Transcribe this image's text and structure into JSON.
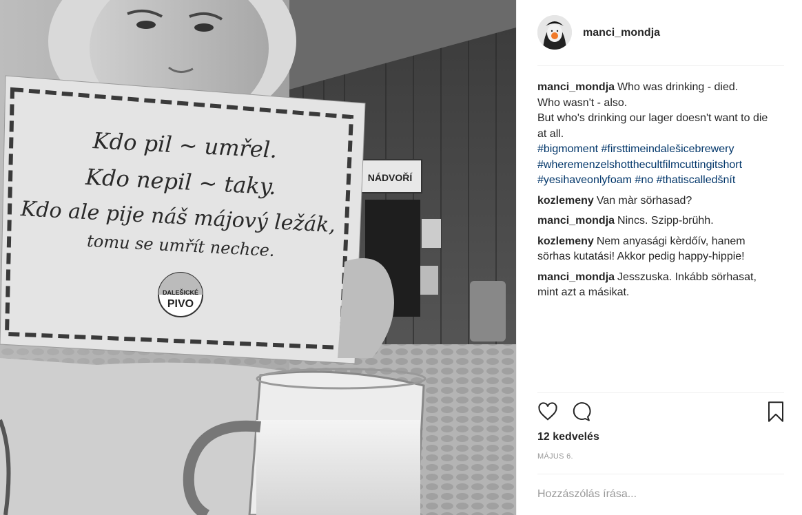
{
  "post": {
    "username": "manci_mondja",
    "avatar_icon": "profile-avatar"
  },
  "photo": {
    "sign": {
      "lines": [
        "Kdo pil ~ umřel.",
        "Kdo nepil ~ taky.",
        "Kdo ale pije náš májový ležák,",
        "tomu se umřít nechce."
      ],
      "badge_lines": [
        "DALEŠICKÉ",
        "PIVO"
      ]
    },
    "wall_sign": "NÁDVOŘÍ"
  },
  "caption": {
    "username": "manci_mondja",
    "lines": [
      "Who was drinking - died.",
      "Who wasn't - also.",
      "But who's drinking our lager doesn't want to die at all."
    ],
    "hashtags": [
      "#bigmoment",
      "#firsttimeindalešicebrewery",
      "#wheremenzelshotthecultfilmcuttingitshort",
      "#yesihaveonlyfoam",
      "#no",
      "#thatiscalledšnít"
    ]
  },
  "comments": [
    {
      "username": "kozlemeny",
      "text": "Van màr sörhasad?"
    },
    {
      "username": "manci_mondja",
      "text": "Nincs. Szipp-brühh."
    },
    {
      "username": "kozlemeny",
      "text": "Nem anyasági kèrdőív, hanem sörhas kutatási! Akkor pedig happy-hippie!"
    },
    {
      "username": "manci_mondja",
      "text": "Jesszuska. Inkább sörhasat, mint azt a másikat."
    }
  ],
  "actions": {
    "like_icon": "heart-icon",
    "comment_icon": "comment-icon",
    "save_icon": "bookmark-icon"
  },
  "likes_text": "12 kedvelés",
  "date_text": "MÁJUS 6.",
  "add_comment_placeholder": "Hozzászólás írása..."
}
